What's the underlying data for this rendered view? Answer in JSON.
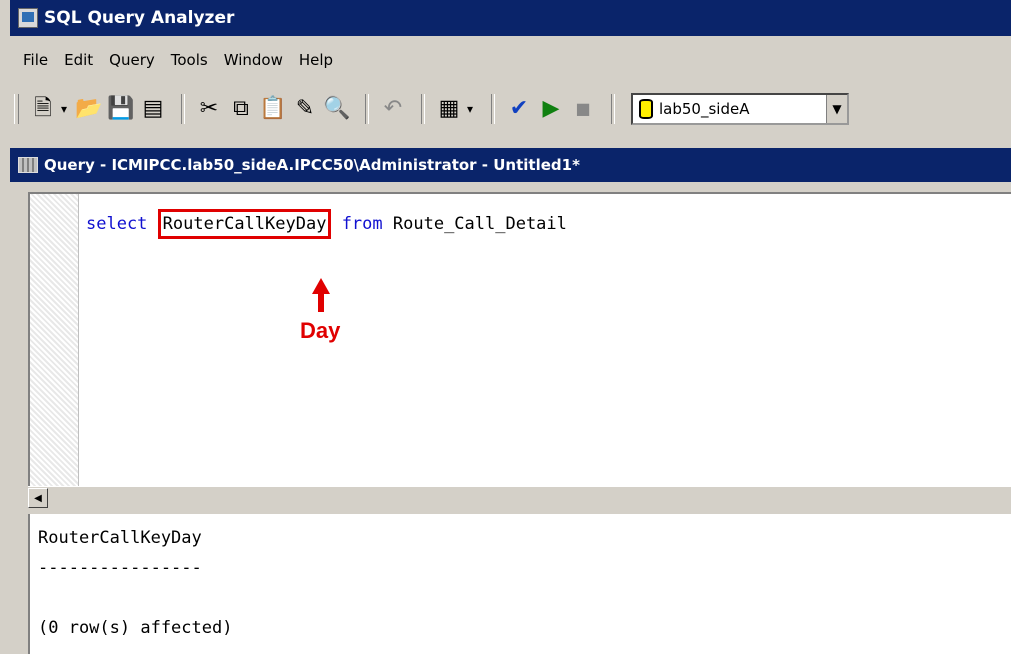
{
  "app": {
    "title": "SQL Query Analyzer",
    "icon": "query-analyzer-app-icon"
  },
  "menu": {
    "items": [
      "File",
      "Edit",
      "Query",
      "Tools",
      "Window",
      "Help"
    ]
  },
  "toolbar": {
    "database": "lab50_sideA"
  },
  "query_window": {
    "title": "Query - ICMIPCC.lab50_sideA.IPCC50\\Administrator - Untitled1*",
    "code": {
      "kw_select": "select",
      "column": "RouterCallKeyDay",
      "kw_from": "from",
      "table": "Route_Call_Detail"
    },
    "annotation": "Day"
  },
  "results": {
    "header": "RouterCallKeyDay",
    "divider": "----------------",
    "status": "(0 row(s) affected)"
  },
  "colors": {
    "title_bar": "#0a246a",
    "keyword": "#1010d0",
    "annotation": "#e00000"
  }
}
